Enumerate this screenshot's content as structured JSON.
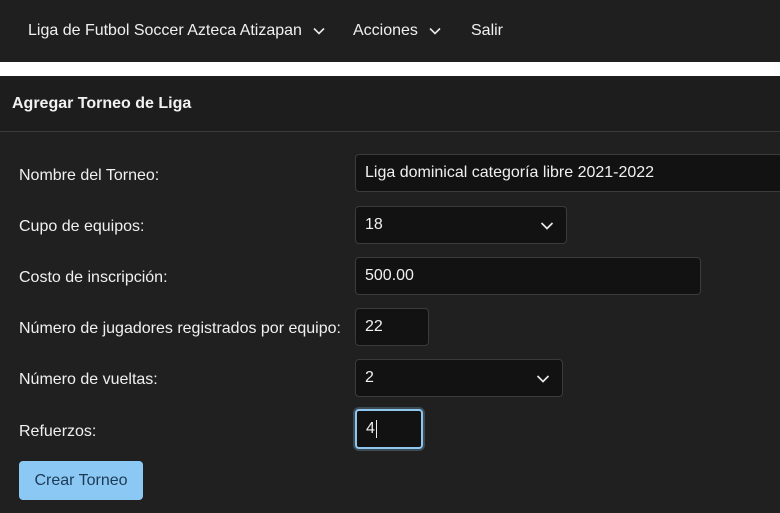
{
  "nav": {
    "brand": "Liga de Futbol Soccer Azteca Atizapan",
    "actions": "Acciones",
    "logout": "Salir"
  },
  "panel": {
    "title": "Agregar Torneo de Liga"
  },
  "form": {
    "name_label": "Nombre del Torneo:",
    "name_value": "Liga dominical categoría libre 2021-2022",
    "teams_label": "Cupo de equipos:",
    "teams_value": "18",
    "cost_label": "Costo de inscripción:",
    "cost_value": "500.00",
    "players_label": "Número de jugadores registrados por equipo:",
    "players_value": "22",
    "rounds_label": "Número de vueltas:",
    "rounds_value": "2",
    "reinforcements_label": "Refuerzos:",
    "reinforcements_value": "4",
    "submit_label": "Crear Torneo"
  },
  "colors": {
    "background": "#1f1f1f",
    "field_background": "#121212",
    "button": "#8cc8f4",
    "focus_ring": "#8ec6f0"
  }
}
